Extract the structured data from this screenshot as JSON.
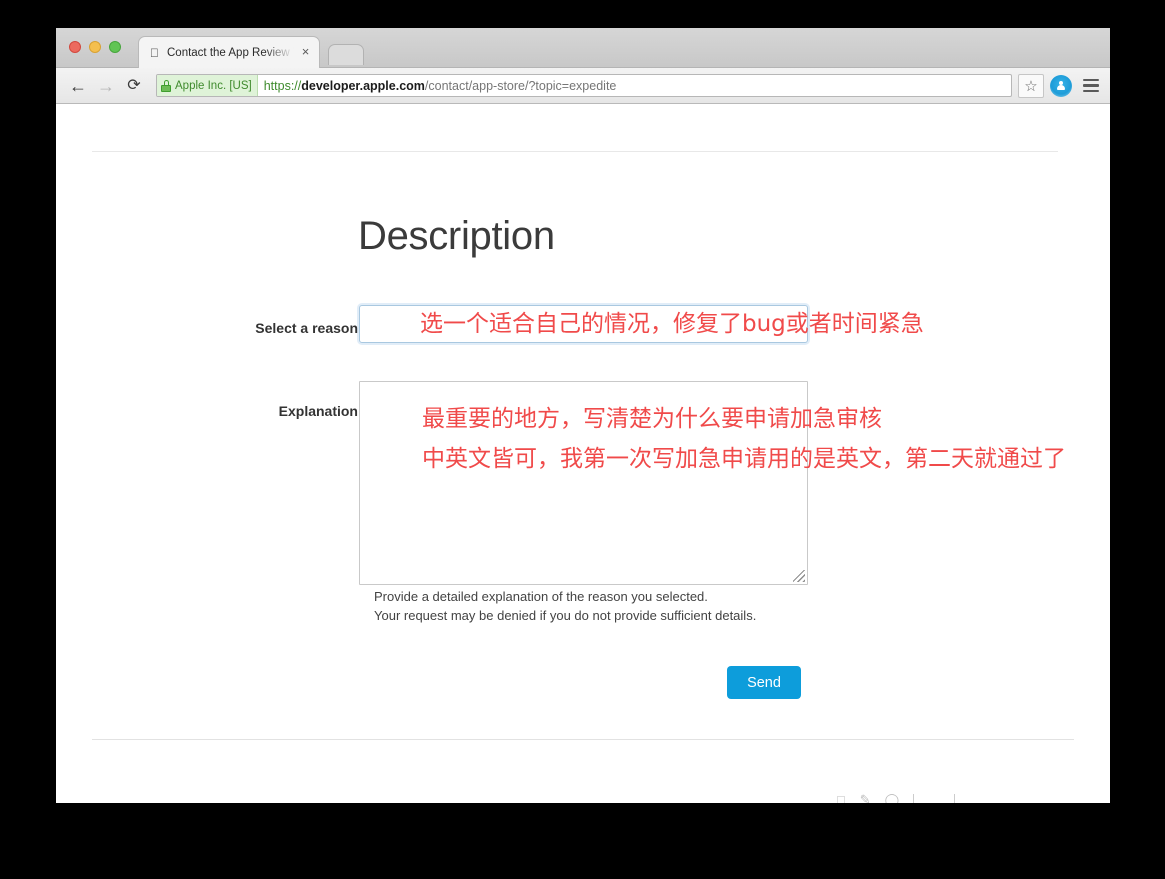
{
  "browser": {
    "window_controls": [
      "close",
      "minimize",
      "maximize"
    ],
    "tab": {
      "title": "Contact the App Review Te",
      "favicon": "apple-logo-icon",
      "close_label": "×"
    },
    "new_tab_label": "",
    "nav": {
      "back_label": "←",
      "forward_label": "→",
      "reload_label": "⟳"
    },
    "omnibox": {
      "security_label": "Apple Inc. [US]",
      "lock_icon": "lock-icon",
      "url_scheme": "https://",
      "url_host": "developer.apple.com",
      "url_path": "/contact/app-store/?topic=expedite",
      "full_url": "https://developer.apple.com/contact/app-store/?topic=expedite"
    },
    "actions": {
      "bookmark_label": "☆",
      "profile_label": "",
      "menu_label": ""
    }
  },
  "page": {
    "title": "Description",
    "fields": {
      "reason": {
        "label": "Select a reason",
        "value": ""
      },
      "explanation": {
        "label": "Explanation",
        "value": ""
      }
    },
    "help": {
      "line1": "Provide a detailed explanation of the reason you selected.",
      "line2": "Your request may be denied if you do not provide sufficient details."
    },
    "submit_label": "Send"
  },
  "annotations": {
    "reason_note": "选一个适合自己的情况，修复了bug或者时间紧急",
    "explanation_note_line1": "最重要的地方，写清楚为什么要申请加急审核",
    "explanation_note_line2": "中英文皆可，我第一次写加急申请用的是英文，第二天就通过了",
    "color": "#f04a4a"
  },
  "colors": {
    "accent_blue": "#0d9ddb",
    "annotation_red": "#f04a4a",
    "secure_green": "#3f8b2d",
    "page_background": "#ffffff",
    "screen_background": "#000000"
  }
}
